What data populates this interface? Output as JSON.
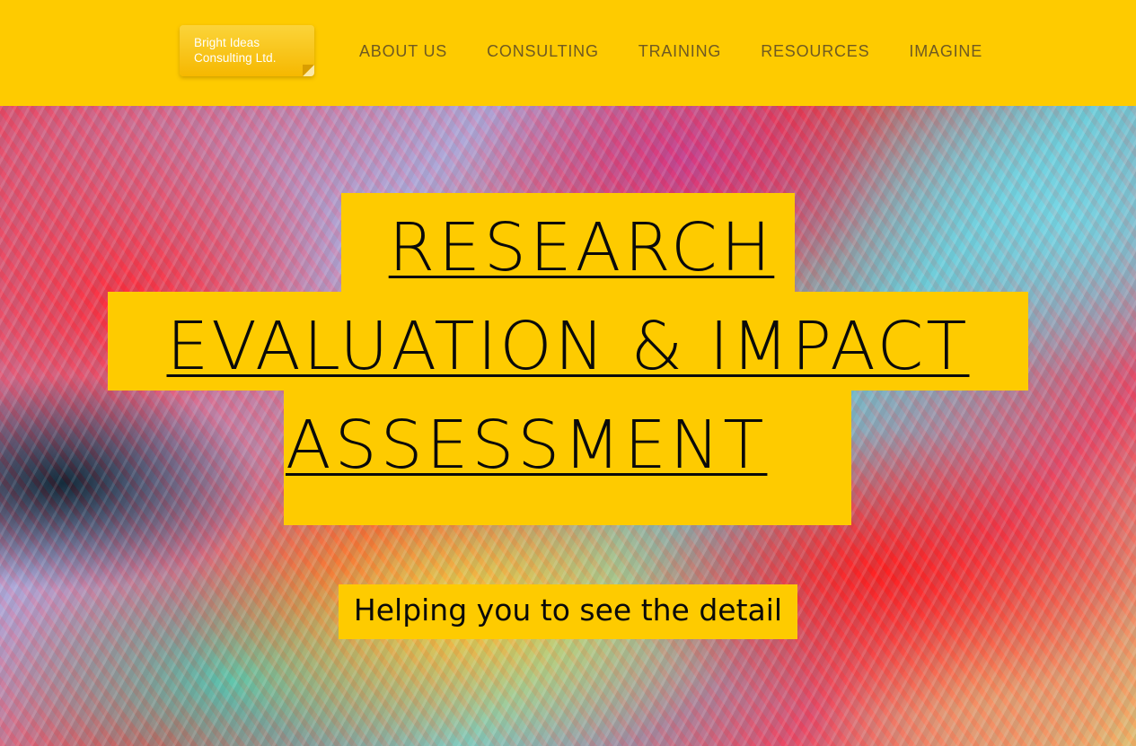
{
  "header": {
    "logo_text": "Bright Ideas\nConsulting Ltd.",
    "nav": [
      {
        "label": "ABOUT US"
      },
      {
        "label": "CONSULTING"
      },
      {
        "label": "TRAINING"
      },
      {
        "label": "RESOURCES"
      },
      {
        "label": "IMAGINE"
      }
    ]
  },
  "hero": {
    "headline": [
      "RESEARCH",
      "EVALUATION & IMPACT",
      "ASSESSMENT"
    ],
    "tagline": "Helping you to see the detail"
  },
  "colors": {
    "brand_yellow": "#fecb00",
    "nav_text": "#6f5a22",
    "headline_text": "#0a0a0a",
    "logo_text": "#ffffff"
  }
}
